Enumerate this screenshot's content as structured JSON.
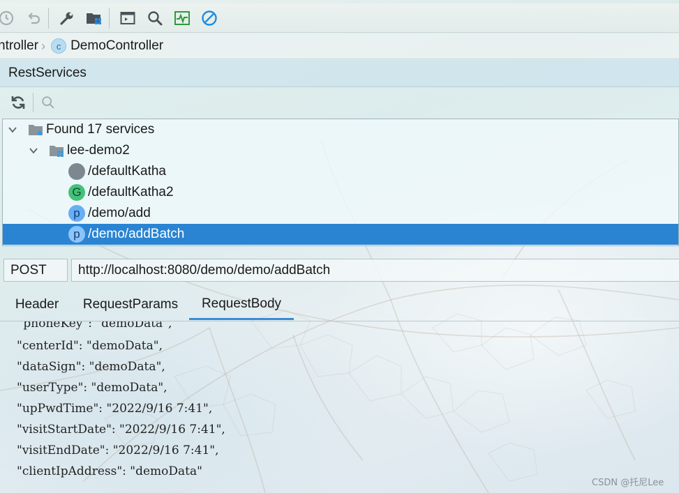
{
  "breadcrumb": {
    "parent": "ntroller",
    "class_badge": "c",
    "current": "DemoController"
  },
  "panel": {
    "title": "RestServices"
  },
  "tree": {
    "root": "Found 17 services",
    "module": "lee-demo2",
    "items": [
      {
        "method": "",
        "path": "/defaultKatha"
      },
      {
        "method": "G",
        "path": "/defaultKatha2"
      },
      {
        "method": "p",
        "path": "/demo/add"
      },
      {
        "method": "p",
        "path": "/demo/addBatch",
        "selected": true
      }
    ]
  },
  "request": {
    "method": "POST",
    "url": "http://localhost:8080/demo/demo/addBatch"
  },
  "tabs": [
    {
      "label": "Header"
    },
    {
      "label": "RequestParams"
    },
    {
      "label": "RequestBody",
      "active": true
    }
  ],
  "body_lines": [
    " phoneKey\": \"demoData\",",
    "\"centerId\": \"demoData\",",
    "\"dataSign\": \"demoData\",",
    "\"userType\": \"demoData\",",
    "\"upPwdTime\": \"2022/9/16 7:41\",",
    "\"visitStartDate\": \"2022/9/16 7:41\",",
    "\"visitEndDate\": \"2022/9/16 7:41\",",
    "\"clientIpAddress\": \"demoData\""
  ],
  "watermark": "CSDN @托尼Lee",
  "colors": {
    "selection": "#2a84d2",
    "tab_underline": "#3b8bd8",
    "get_badge": "#45c07a",
    "post_badge": "#67aef5",
    "cancel_icon": "#1f8de0",
    "monitor_icon": "#2e9a3c"
  },
  "icons": {
    "toolbar": [
      "history-icon",
      "undo-icon",
      "wrench-icon",
      "project-structure-icon",
      "run-console-icon",
      "search-icon",
      "activity-monitor-icon",
      "cancel-icon"
    ],
    "panel_toolbar": [
      "refresh-icon",
      "search-icon"
    ]
  }
}
